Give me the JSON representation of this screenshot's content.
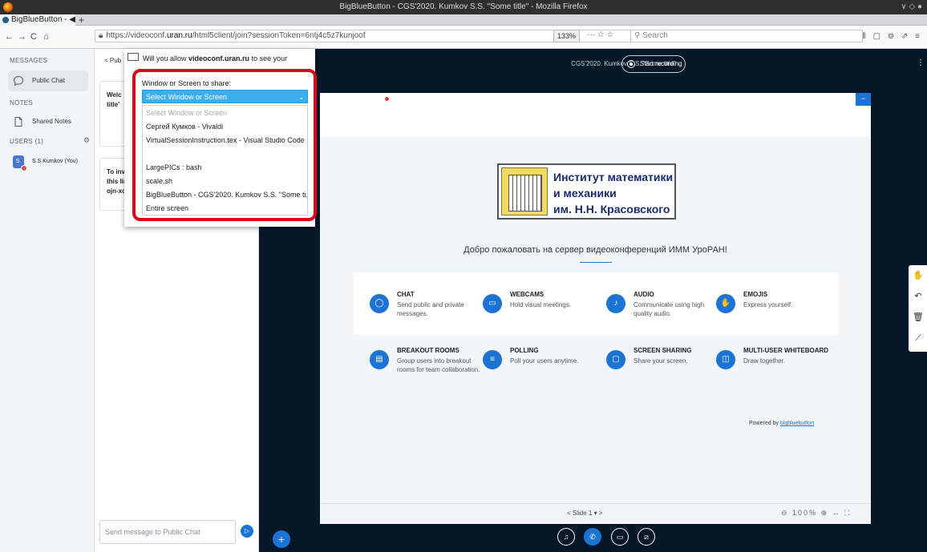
{
  "window": {
    "title": "BigBlueButton - CGS'2020. Kumkov S.S. \"Some title\" - Mozilla Firefox",
    "controls": "∨ ◇ ●"
  },
  "tab": {
    "label": "BigBlueButton -",
    "indicators": "◀ ×",
    "newtab": "+"
  },
  "nav": {
    "back": "←",
    "forward": "→",
    "reload": "C",
    "home": "⌂",
    "url_prefix": "https://videoconf.",
    "url_domain": "uran.ru",
    "url_path": "/html5client/join?sessionToken=6ntj4c5z7kunjoof",
    "zoom": "133%",
    "url_icons": "··· ☆ ☆",
    "search_placeholder": "Search",
    "right_icons": "⫴ ▢ ⊚ ⇗ ≡"
  },
  "sidebar": {
    "messages_title": "MESSAGES",
    "public_chat": "Public Chat",
    "notes_title": "NOTES",
    "shared_notes": "Shared Notes",
    "users_title": "USERS (1)",
    "user_initials": "S.",
    "user_name": "S.S.Kumkov (You)"
  },
  "chat": {
    "back_label": "< Pub",
    "welcome_a": "Welc",
    "welcome_b": "title'",
    "invite_a": "To invite",
    "invite_b": "this link:",
    "invite_c": "ojn-xoh",
    "input_placeholder": "Send message to Public Chat",
    "send_icon": "▷"
  },
  "main": {
    "meeting_title": "CGS'2020. Kumkov S.S. \"Some title\"",
    "record_label": "Start recording",
    "kebab": "⋮"
  },
  "slide": {
    "logo_text": [
      "Институт математики",
      "и механики",
      "им. Н.Н. Красовского"
    ],
    "welcome": "Добро пожаловать на сервер видеоконференций ИММ УроРАН!",
    "features": [
      {
        "title": "CHAT",
        "desc": "Send public and private messages."
      },
      {
        "title": "WEBCAMS",
        "desc": "Hold visual meetings."
      },
      {
        "title": "AUDIO",
        "desc": "Communicate using high quality audio."
      },
      {
        "title": "EMOJIS",
        "desc": "Express yourself."
      },
      {
        "title": "BREAKOUT ROOMS",
        "desc": "Group users into breakout rooms for team collaboration."
      },
      {
        "title": "POLLING",
        "desc": "Poll your users anytime."
      },
      {
        "title": "SCREEN SHARING",
        "desc": "Share your screen."
      },
      {
        "title": "MULTI-USER WHITEBOARD",
        "desc": "Draw together."
      }
    ],
    "powered_by_prefix": "Powered by",
    "powered_by_link": "bigbluebutton",
    "slide_label": "< Slide 1 ▾ >",
    "zoom_controls": "⊖ 100% ⊕ ↔ ⛶",
    "collapse_icon": "−"
  },
  "share_dialog": {
    "question_prefix": "Will you allow",
    "question_domain": "videoconf.uran.ru",
    "question_suffix": "to see your",
    "label": "Window or Screen to share:",
    "selected": "Select Window or Screen",
    "options": [
      "Select Window or Screen",
      "Сергей Кумков - Vivaldi",
      "VirtualSessionInstruction.tex - Visual Studio Code",
      "",
      "LargePICs : bash",
      "scale.sh",
      "BigBlueButton - CGS'2020. Kumkov S.S. \"Some ti...",
      "Entire screen"
    ]
  }
}
